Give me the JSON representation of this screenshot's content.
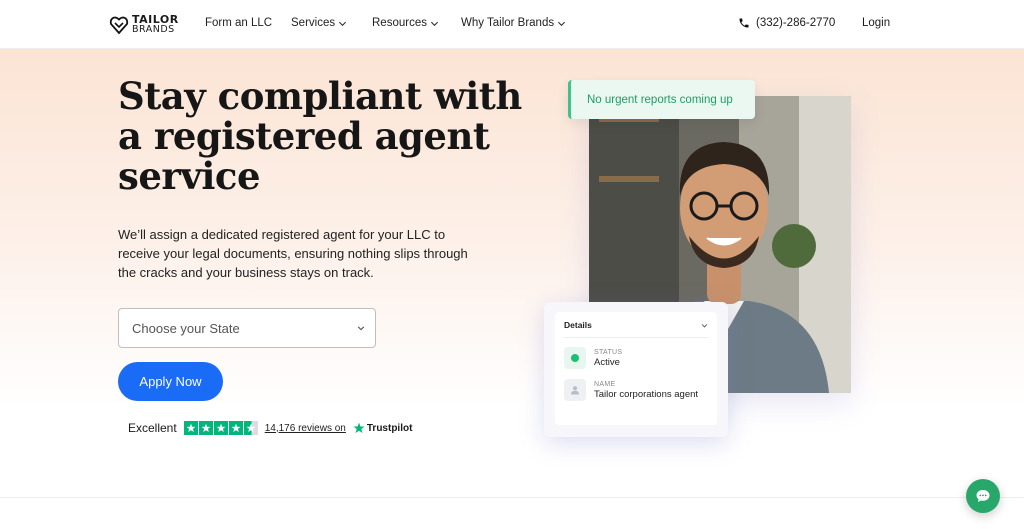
{
  "header": {
    "logo_line1": "TAILOR",
    "logo_line2": "BRANDS",
    "nav": [
      {
        "label": "Form an LLC",
        "has_dropdown": false
      },
      {
        "label": "Services",
        "has_dropdown": true
      },
      {
        "label": "Resources",
        "has_dropdown": true
      },
      {
        "label": "Why Tailor Brands",
        "has_dropdown": true
      }
    ],
    "phone": "(332)-286-2770",
    "login": "Login"
  },
  "hero": {
    "title": "Stay compliant with a registered agent service",
    "description": "We’ll assign a dedicated registered agent for your LLC to receive your legal documents, ensuring nothing slips through the cracks and your business stays on track.",
    "state_select": {
      "placeholder": "Choose your State"
    },
    "apply_button": "Apply Now",
    "trustpilot": {
      "rating_word": "Excellent",
      "stars": 4.5,
      "reviews_link": "14,176 reviews on",
      "brand": "Trustpilot"
    }
  },
  "illustration": {
    "toast": "No urgent reports coming up",
    "details_card": {
      "title": "Details",
      "status_label": "STATUS",
      "status_value": "Active",
      "name_label": "NAME",
      "name_value": "Tailor corporations agent"
    }
  },
  "colors": {
    "accent": "#1a6bf5",
    "trustpilot_green": "#00b67a",
    "status_green": "#1fbf73",
    "chat_green": "#28a76a",
    "hero_bg_top": "#fbe4d4"
  },
  "icons": [
    "logo-icon",
    "chevron-down-icon",
    "phone-icon",
    "star-icon",
    "trustpilot-star-icon",
    "person-icon",
    "chat-icon"
  ]
}
